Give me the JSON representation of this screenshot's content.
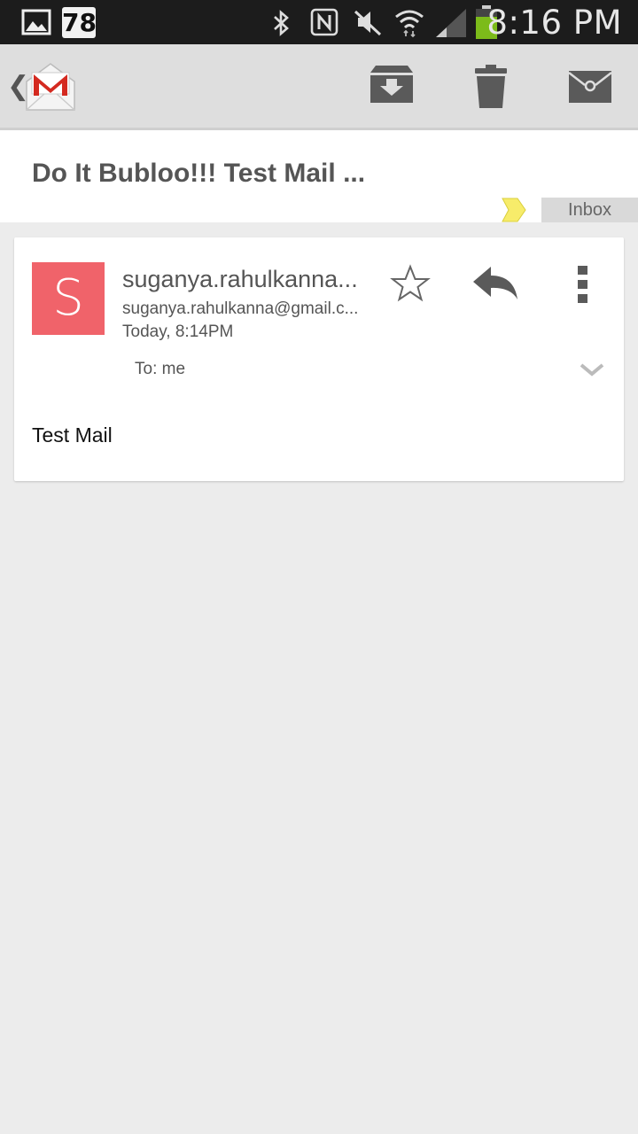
{
  "status_bar": {
    "time": "8:16 PM",
    "notification_count": "78",
    "icons": [
      "image-notification-icon",
      "bluetooth-icon",
      "nfc-icon",
      "mute-icon",
      "wifi-icon",
      "signal-icon",
      "battery-icon"
    ]
  },
  "action_bar": {
    "app_icon": "gmail-icon",
    "actions": [
      "archive-icon",
      "trash-icon",
      "mark-unread-icon"
    ]
  },
  "message": {
    "subject": "Do It Bubloo!!! Test Mail ...",
    "labels": [
      "Inbox"
    ],
    "sender_name": "suganya.rahulkanna...",
    "sender_email": "suganya.rahulkanna@gmail.c...",
    "timestamp": "Today, 8:14PM",
    "recipients": "To: me",
    "avatar_letter": "S",
    "body": "Test Mail"
  },
  "colors": {
    "avatar": "#f0636a",
    "importance_marker": "#f7ec6a",
    "background": "#ececec"
  }
}
